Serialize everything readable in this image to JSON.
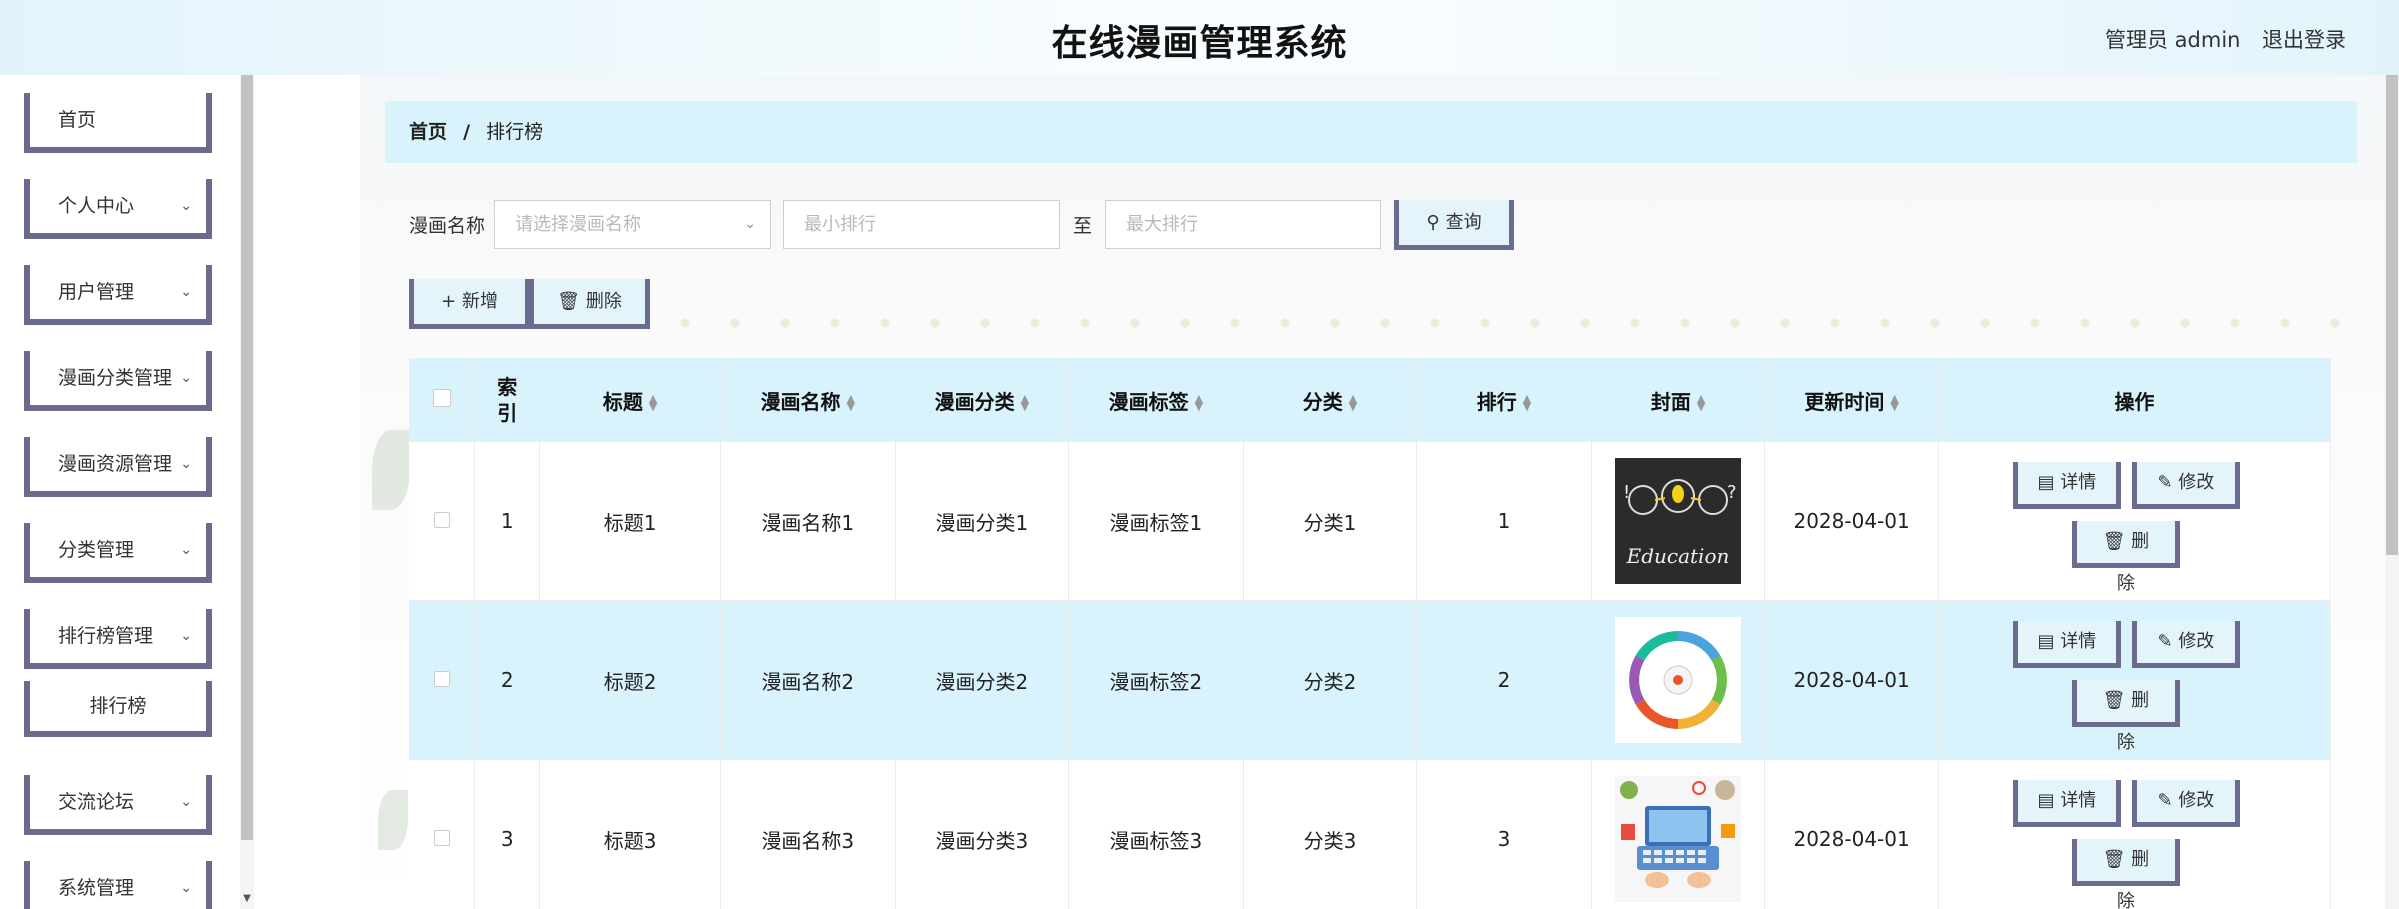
{
  "header": {
    "title": "在线漫画管理系统",
    "user": "管理员 admin",
    "logout": "退出登录"
  },
  "sidebar": {
    "items": [
      {
        "label": "首页"
      },
      {
        "label": "个人中心"
      },
      {
        "label": "用户管理"
      },
      {
        "label": "漫画分类管理"
      },
      {
        "label": "漫画资源管理"
      },
      {
        "label": "分类管理"
      },
      {
        "label": "排行榜管理"
      },
      {
        "label": "排行榜"
      },
      {
        "label": "交流论坛"
      },
      {
        "label": "系统管理"
      }
    ]
  },
  "breadcrumb": {
    "home": "首页",
    "separator": "/",
    "current": "排行榜"
  },
  "search": {
    "label": "漫画名称",
    "select_placeholder": "请选择漫画名称",
    "min_placeholder": "最小排行",
    "to_label": "至",
    "max_placeholder": "最大排行",
    "query_button": "查询"
  },
  "toolbar": {
    "add_button": "新增",
    "delete_button": "删除"
  },
  "table": {
    "columns": [
      "索引",
      "标题",
      "漫画名称",
      "漫画分类",
      "漫画标签",
      "分类",
      "排行",
      "封面",
      "更新时间",
      "操作"
    ],
    "rows": [
      {
        "index": "1",
        "title": "标题1",
        "name": "漫画名称1",
        "category": "漫画分类1",
        "tag": "漫画标签1",
        "class": "分类1",
        "rank": "1",
        "cover": "education-chalkboard",
        "time": "2028-04-01"
      },
      {
        "index": "2",
        "title": "标题2",
        "name": "漫画名称2",
        "category": "漫画分类2",
        "tag": "漫画标签2",
        "class": "分类2",
        "rank": "2",
        "cover": "tech-wheel-diagram",
        "time": "2028-04-01"
      },
      {
        "index": "3",
        "title": "标题3",
        "name": "漫画名称3",
        "category": "漫画分类3",
        "tag": "漫画标签3",
        "class": "分类3",
        "rank": "3",
        "cover": "laptop-desk",
        "time": "2028-04-01"
      }
    ],
    "actions": {
      "detail": "详情",
      "edit": "修改",
      "delete": "删除"
    }
  },
  "colors": {
    "accent_border": "#6b6b8f",
    "header_bg": "#d9f3fd",
    "button_bg": "#e3f4fb"
  }
}
